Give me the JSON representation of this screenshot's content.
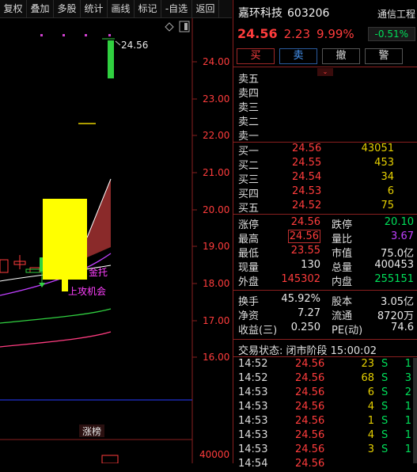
{
  "toolbar": [
    "复权",
    "叠加",
    "多股",
    "统计",
    "画线",
    "标记",
    "-自选",
    "返回"
  ],
  "chart": {
    "price_labels": [
      "24.00",
      "23.00",
      "22.00",
      "21.00",
      "20.00",
      "19.00",
      "18.00",
      "17.00",
      "16.00"
    ],
    "volume_label": "40000",
    "high_marker": "24.56",
    "annotations": {
      "tuo": "金托",
      "attack": "上攻机会",
      "zhangbang": "涨榜"
    }
  },
  "quote": {
    "name": "嘉环科技",
    "code": "603206",
    "sector": "通信工程",
    "sector_change": "-0.51%",
    "price": "24.56",
    "change": "2.23",
    "change_pct": "9.99%",
    "buttons": {
      "buy": "买",
      "sell": "卖",
      "cancel": "撤",
      "alert": "警"
    },
    "asks": [
      {
        "label": "卖五"
      },
      {
        "label": "卖四"
      },
      {
        "label": "卖三"
      },
      {
        "label": "卖二"
      },
      {
        "label": "卖一"
      }
    ],
    "bids": [
      {
        "label": "买一",
        "price": "24.56",
        "vol": "43051"
      },
      {
        "label": "买二",
        "price": "24.55",
        "vol": "453"
      },
      {
        "label": "买三",
        "price": "24.54",
        "vol": "34"
      },
      {
        "label": "买四",
        "price": "24.53",
        "vol": "6"
      },
      {
        "label": "买五",
        "price": "24.52",
        "vol": "75"
      }
    ],
    "stats1": {
      "zt_l": "涨停",
      "zt_v": "24.56",
      "dt_l": "跌停",
      "dt_v": "20.10",
      "zg_l": "最高",
      "zg_v": "24.56",
      "lb_l": "量比",
      "lb_v": "3.67",
      "zd_l": "最低",
      "zd_v": "23.55",
      "sz_l": "市值",
      "sz_v": "75.0亿",
      "xl_l": "现量",
      "xl_v": "130",
      "zl_l": "总量",
      "zl_v": "400453",
      "wp_l": "外盘",
      "wp_v": "145302",
      "np_l": "内盘",
      "np_v": "255151"
    },
    "stats2": {
      "hs_l": "换手",
      "hs_v": "45.92%",
      "gb_l": "股本",
      "gb_v": "3.05亿",
      "jz_l": "净资",
      "jz_v": "7.27",
      "lt_l": "流通",
      "lt_v": "8720万",
      "sy_l": "收益(三)",
      "sy_v": "0.250",
      "pe_l": "PE(动)",
      "pe_v": "74.6"
    },
    "status": "交易状态: 闭市阶段 15:00:02",
    "ticks": [
      {
        "t": "14:52",
        "p": "24.56",
        "v": "23",
        "s": "S",
        "n": "1"
      },
      {
        "t": "14:52",
        "p": "24.56",
        "v": "68",
        "s": "S",
        "n": "3"
      },
      {
        "t": "14:53",
        "p": "24.56",
        "v": "6",
        "s": "S",
        "n": "2"
      },
      {
        "t": "14:53",
        "p": "24.56",
        "v": "4",
        "s": "S",
        "n": "1"
      },
      {
        "t": "14:53",
        "p": "24.56",
        "v": "1",
        "s": "S",
        "n": "1"
      },
      {
        "t": "14:53",
        "p": "24.56",
        "v": "4",
        "s": "S",
        "n": "1"
      },
      {
        "t": "14:53",
        "p": "24.56",
        "v": "3",
        "s": "S",
        "n": "1"
      },
      {
        "t": "14:54",
        "p": "24.56",
        "v": "",
        "s": "",
        "n": ""
      }
    ]
  }
}
